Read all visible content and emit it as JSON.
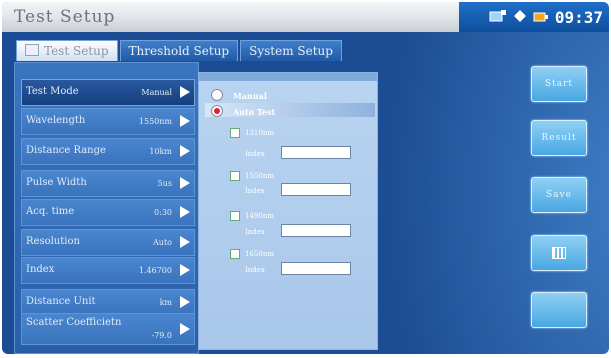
{
  "window": {
    "title": "Test Setup"
  },
  "status": {
    "time": "09:37"
  },
  "tabs": [
    {
      "label": "Test Setup",
      "active": true
    },
    {
      "label": "Threshold Setup",
      "active": false
    },
    {
      "label": "System Setup",
      "active": false
    }
  ],
  "settings": [
    {
      "label": "Test Mode",
      "value": "Manual"
    },
    {
      "label": "Wavelength",
      "value": "1550nm"
    },
    {
      "label": "Distance Range",
      "value": "10km"
    },
    {
      "label": "Pulse Width",
      "value": "5us"
    },
    {
      "label": "Acq. time",
      "value": "0:30"
    },
    {
      "label": "Resolution",
      "value": "Auto"
    },
    {
      "label": "Index",
      "value": "1.46700"
    },
    {
      "label": "Distance Unit",
      "value": "km"
    },
    {
      "label": "Scatter Coefficietn",
      "value": "-79.0"
    }
  ],
  "mode_options": [
    {
      "label": "Manual",
      "selected": false
    },
    {
      "label": "Auto Test",
      "selected": true
    }
  ],
  "wavelengths": [
    {
      "label": "1310nm",
      "index_label": "Index",
      "index_value": ""
    },
    {
      "label": "1550nm",
      "index_label": "Index",
      "index_value": ""
    },
    {
      "label": "1490nm",
      "index_label": "Index",
      "index_value": ""
    },
    {
      "label": "1650nm",
      "index_label": "Index",
      "index_value": ""
    }
  ],
  "side_buttons": [
    {
      "label": "Start",
      "icon": ""
    },
    {
      "label": "Result",
      "icon": ""
    },
    {
      "label": "Save",
      "icon": ""
    },
    {
      "label": "",
      "icon": "calculator-icon"
    },
    {
      "label": "",
      "icon": ""
    }
  ],
  "colors": {
    "accent": "#2d63aa",
    "status_bar": "#1565c0",
    "selected_radio": "#d22233"
  }
}
